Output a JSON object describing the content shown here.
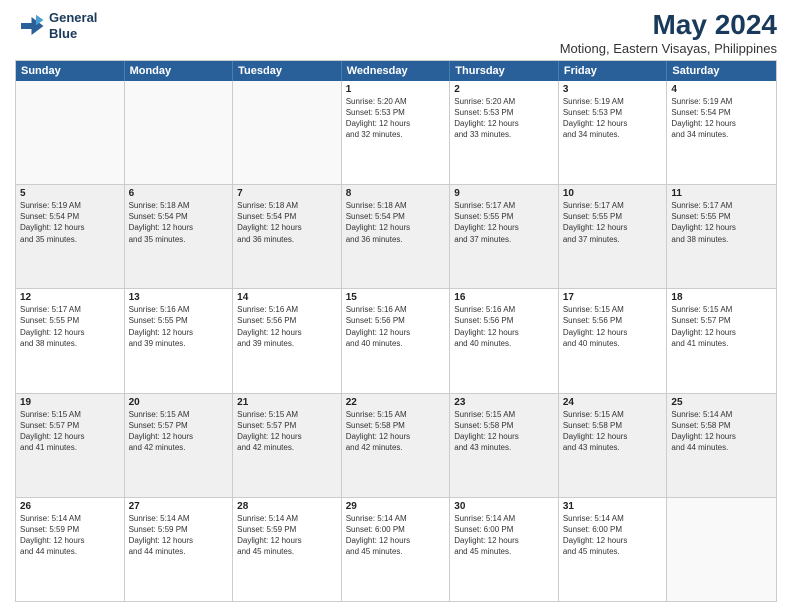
{
  "logo": {
    "line1": "General",
    "line2": "Blue"
  },
  "title": "May 2024",
  "subtitle": "Motiong, Eastern Visayas, Philippines",
  "header_days": [
    "Sunday",
    "Monday",
    "Tuesday",
    "Wednesday",
    "Thursday",
    "Friday",
    "Saturday"
  ],
  "weeks": [
    [
      {
        "day": "",
        "info": ""
      },
      {
        "day": "",
        "info": ""
      },
      {
        "day": "",
        "info": ""
      },
      {
        "day": "1",
        "info": "Sunrise: 5:20 AM\nSunset: 5:53 PM\nDaylight: 12 hours\nand 32 minutes."
      },
      {
        "day": "2",
        "info": "Sunrise: 5:20 AM\nSunset: 5:53 PM\nDaylight: 12 hours\nand 33 minutes."
      },
      {
        "day": "3",
        "info": "Sunrise: 5:19 AM\nSunset: 5:53 PM\nDaylight: 12 hours\nand 34 minutes."
      },
      {
        "day": "4",
        "info": "Sunrise: 5:19 AM\nSunset: 5:54 PM\nDaylight: 12 hours\nand 34 minutes."
      }
    ],
    [
      {
        "day": "5",
        "info": "Sunrise: 5:19 AM\nSunset: 5:54 PM\nDaylight: 12 hours\nand 35 minutes."
      },
      {
        "day": "6",
        "info": "Sunrise: 5:18 AM\nSunset: 5:54 PM\nDaylight: 12 hours\nand 35 minutes."
      },
      {
        "day": "7",
        "info": "Sunrise: 5:18 AM\nSunset: 5:54 PM\nDaylight: 12 hours\nand 36 minutes."
      },
      {
        "day": "8",
        "info": "Sunrise: 5:18 AM\nSunset: 5:54 PM\nDaylight: 12 hours\nand 36 minutes."
      },
      {
        "day": "9",
        "info": "Sunrise: 5:17 AM\nSunset: 5:55 PM\nDaylight: 12 hours\nand 37 minutes."
      },
      {
        "day": "10",
        "info": "Sunrise: 5:17 AM\nSunset: 5:55 PM\nDaylight: 12 hours\nand 37 minutes."
      },
      {
        "day": "11",
        "info": "Sunrise: 5:17 AM\nSunset: 5:55 PM\nDaylight: 12 hours\nand 38 minutes."
      }
    ],
    [
      {
        "day": "12",
        "info": "Sunrise: 5:17 AM\nSunset: 5:55 PM\nDaylight: 12 hours\nand 38 minutes."
      },
      {
        "day": "13",
        "info": "Sunrise: 5:16 AM\nSunset: 5:55 PM\nDaylight: 12 hours\nand 39 minutes."
      },
      {
        "day": "14",
        "info": "Sunrise: 5:16 AM\nSunset: 5:56 PM\nDaylight: 12 hours\nand 39 minutes."
      },
      {
        "day": "15",
        "info": "Sunrise: 5:16 AM\nSunset: 5:56 PM\nDaylight: 12 hours\nand 40 minutes."
      },
      {
        "day": "16",
        "info": "Sunrise: 5:16 AM\nSunset: 5:56 PM\nDaylight: 12 hours\nand 40 minutes."
      },
      {
        "day": "17",
        "info": "Sunrise: 5:15 AM\nSunset: 5:56 PM\nDaylight: 12 hours\nand 40 minutes."
      },
      {
        "day": "18",
        "info": "Sunrise: 5:15 AM\nSunset: 5:57 PM\nDaylight: 12 hours\nand 41 minutes."
      }
    ],
    [
      {
        "day": "19",
        "info": "Sunrise: 5:15 AM\nSunset: 5:57 PM\nDaylight: 12 hours\nand 41 minutes."
      },
      {
        "day": "20",
        "info": "Sunrise: 5:15 AM\nSunset: 5:57 PM\nDaylight: 12 hours\nand 42 minutes."
      },
      {
        "day": "21",
        "info": "Sunrise: 5:15 AM\nSunset: 5:57 PM\nDaylight: 12 hours\nand 42 minutes."
      },
      {
        "day": "22",
        "info": "Sunrise: 5:15 AM\nSunset: 5:58 PM\nDaylight: 12 hours\nand 42 minutes."
      },
      {
        "day": "23",
        "info": "Sunrise: 5:15 AM\nSunset: 5:58 PM\nDaylight: 12 hours\nand 43 minutes."
      },
      {
        "day": "24",
        "info": "Sunrise: 5:15 AM\nSunset: 5:58 PM\nDaylight: 12 hours\nand 43 minutes."
      },
      {
        "day": "25",
        "info": "Sunrise: 5:14 AM\nSunset: 5:58 PM\nDaylight: 12 hours\nand 44 minutes."
      }
    ],
    [
      {
        "day": "26",
        "info": "Sunrise: 5:14 AM\nSunset: 5:59 PM\nDaylight: 12 hours\nand 44 minutes."
      },
      {
        "day": "27",
        "info": "Sunrise: 5:14 AM\nSunset: 5:59 PM\nDaylight: 12 hours\nand 44 minutes."
      },
      {
        "day": "28",
        "info": "Sunrise: 5:14 AM\nSunset: 5:59 PM\nDaylight: 12 hours\nand 45 minutes."
      },
      {
        "day": "29",
        "info": "Sunrise: 5:14 AM\nSunset: 6:00 PM\nDaylight: 12 hours\nand 45 minutes."
      },
      {
        "day": "30",
        "info": "Sunrise: 5:14 AM\nSunset: 6:00 PM\nDaylight: 12 hours\nand 45 minutes."
      },
      {
        "day": "31",
        "info": "Sunrise: 5:14 AM\nSunset: 6:00 PM\nDaylight: 12 hours\nand 45 minutes."
      },
      {
        "day": "",
        "info": ""
      }
    ]
  ]
}
